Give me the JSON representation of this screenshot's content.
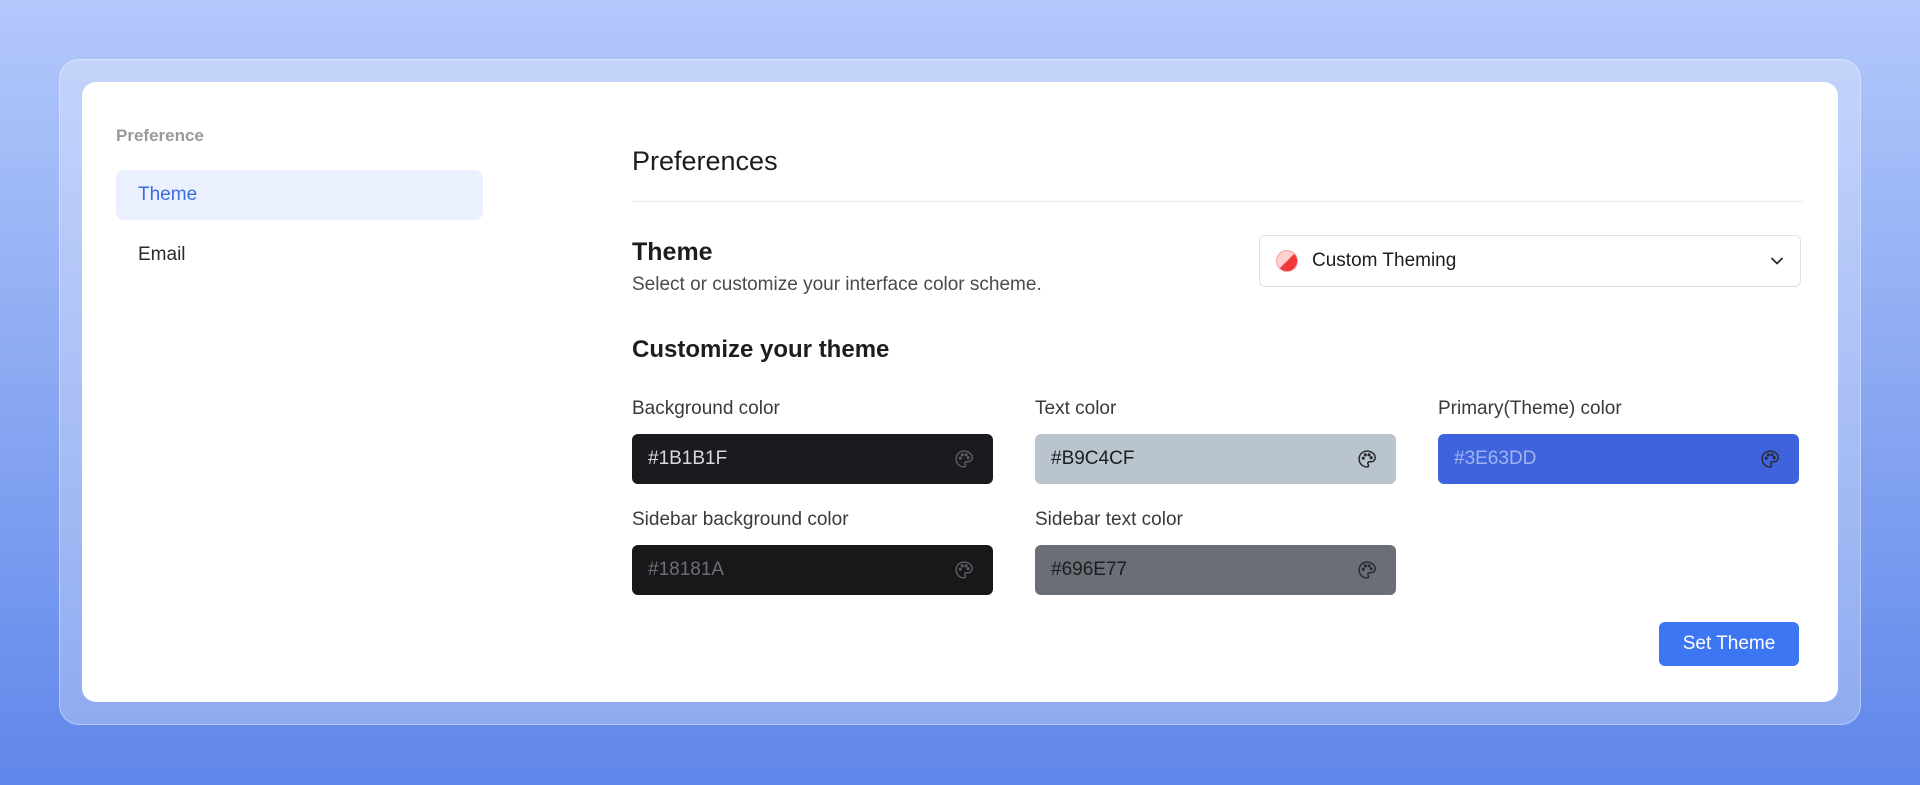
{
  "sidebar": {
    "heading": "Preference",
    "items": [
      {
        "label": "Theme",
        "active": true
      },
      {
        "label": "Email",
        "active": false
      }
    ]
  },
  "main": {
    "title": "Preferences",
    "theme": {
      "title": "Theme",
      "description": "Select or customize your interface color scheme.",
      "selected": "Custom Theming"
    },
    "customize": {
      "title": "Customize your theme",
      "fields": [
        {
          "label": "Background color",
          "value": "#1B1B1F",
          "bg": "#1B1B1F",
          "text": "#d9d9de"
        },
        {
          "label": "Text color",
          "value": "#B9C4CF",
          "bg": "#B9C4CF",
          "text": "#1d1d1d"
        },
        {
          "label": "Primary(Theme) color",
          "value": "#3E63DD",
          "bg": "#3E63DD",
          "text": "#9fb3ef"
        },
        {
          "label": "Sidebar background color",
          "value": "#18181A",
          "bg": "#18181A",
          "text": "#6e6e73"
        },
        {
          "label": "Sidebar text color",
          "value": "#696E77",
          "bg": "#696E77",
          "text": "#1d1d1d"
        }
      ]
    },
    "submit_label": "Set Theme"
  },
  "colors": {
    "accent": "#3d76f2",
    "active_item_bg": "#eaf0fd",
    "active_item_text": "#3d6ce0"
  },
  "icons": {
    "select": "theme-swatch-icon",
    "dropdown": "chevron-down-icon",
    "color_picker": "palette-icon"
  }
}
